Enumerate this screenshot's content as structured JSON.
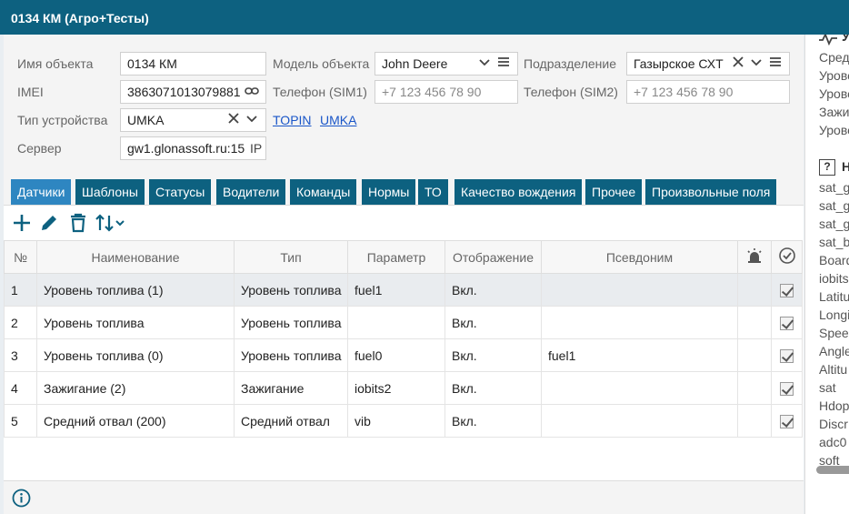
{
  "window": {
    "title": "0134 КМ (Агро+Тесты)"
  },
  "form": {
    "name_label": "Имя объекта",
    "name_value": "0134 КМ",
    "model_label": "Модель объекта",
    "model_value": "John Deere",
    "division_label": "Подразделение",
    "division_value": "Газырское СХТ",
    "imei_label": "IMEI",
    "imei_value": "3863071013079881",
    "phone1_label": "Телефон (SIM1)",
    "phone1_placeholder": "+7 123 456 78 90",
    "phone2_label": "Телефон (SIM2)",
    "phone2_placeholder": "+7 123 456 78 90",
    "device_type_label": "Тип устройства",
    "device_type_value": "UMKA",
    "device_link_1": "TOPIN",
    "device_link_2": "UMKA",
    "server_label": "Сервер",
    "server_value": "gw1.glonassoft.ru:15",
    "server_suffix": "IP"
  },
  "tabs": [
    {
      "label": "Датчики",
      "active": true
    },
    {
      "label": "Шаблоны"
    },
    {
      "label": "Статусы"
    },
    {
      "label": "Водители"
    },
    {
      "label": "Команды"
    },
    {
      "label": "Нормы"
    },
    {
      "label": "ТО"
    },
    {
      "label": "Качество вождения"
    },
    {
      "label": "Прочее"
    },
    {
      "label": "Произвольные поля"
    }
  ],
  "table": {
    "columns": [
      "№",
      "Наименование",
      "Тип",
      "Параметр",
      "Отображение",
      "Псевдоним"
    ],
    "rows": [
      {
        "num": "1",
        "name": "Уровень топлива (1)",
        "type": "Уровень топлива",
        "param": "fuel1",
        "display": "Вкл.",
        "alias": ""
      },
      {
        "num": "2",
        "name": "Уровень топлива",
        "type": "Уровень топлива",
        "param": "",
        "display": "Вкл.",
        "alias": ""
      },
      {
        "num": "3",
        "name": "Уровень топлива (0)",
        "type": "Уровень топлива",
        "param": "fuel0",
        "display": "Вкл.",
        "alias": "fuel1"
      },
      {
        "num": "4",
        "name": "Зажигание (2)",
        "type": "Зажигание",
        "param": "iobits2",
        "display": "Вкл.",
        "alias": ""
      },
      {
        "num": "5",
        "name": "Средний отвал (200)",
        "type": "Средний отвал",
        "param": "vib",
        "display": "Вкл.",
        "alias": ""
      }
    ]
  },
  "right_panel": {
    "section1_head": "У",
    "section1_items": [
      "Сред",
      "Урове",
      "Урове",
      "Зажи",
      "Урове"
    ],
    "section2_head": "Н",
    "section2_items": [
      "sat_g",
      "sat_g",
      "sat_g",
      "sat_b",
      "Board",
      "iobits",
      "Latitu",
      "Longi",
      "Speed",
      "Angle",
      "Altitu",
      "sat",
      "Hdop",
      "Discr",
      "adc0",
      "soft"
    ]
  },
  "colors": {
    "titlebar": "#0d6180",
    "tab": "#0d6180",
    "tab_active": "#2e86c1",
    "link": "#1a56c8"
  }
}
